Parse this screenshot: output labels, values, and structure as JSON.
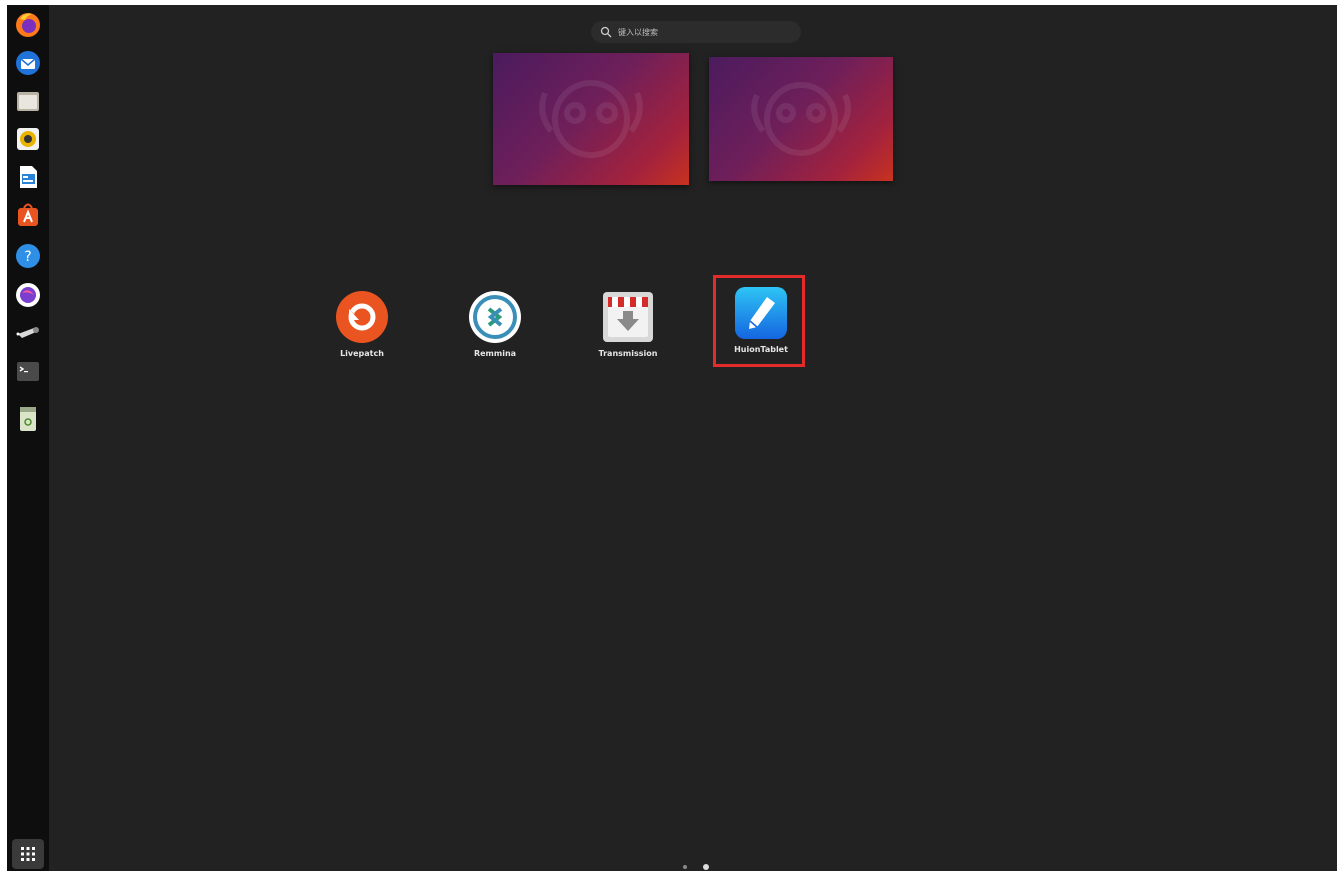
{
  "search": {
    "placeholder": "键入以搜索"
  },
  "dock": {
    "items": [
      {
        "name": "firefox-icon"
      },
      {
        "name": "thunderbird-icon"
      },
      {
        "name": "files-icon"
      },
      {
        "name": "rhythmbox-icon"
      },
      {
        "name": "libreoffice-writer-icon"
      },
      {
        "name": "app-center-icon"
      },
      {
        "name": "help-icon"
      },
      {
        "name": "shotwell-icon"
      },
      {
        "name": "screenshot-tool-icon"
      },
      {
        "name": "terminal-icon"
      },
      {
        "name": "trash-icon"
      }
    ],
    "show_apps_icon": "grid-icon"
  },
  "apps": [
    {
      "label": "Livepatch",
      "icon": "livepatch-icon"
    },
    {
      "label": "Remmina",
      "icon": "remmina-icon"
    },
    {
      "label": "Transmission",
      "icon": "transmission-icon"
    },
    {
      "label": "HuionTablet",
      "icon": "huion-tablet-icon",
      "highlighted": true
    }
  ],
  "pager": {
    "pages": 2,
    "current": 2
  },
  "colors": {
    "highlight": "#e42b2b",
    "background": "#222222",
    "dock": "#0e0e0e"
  }
}
